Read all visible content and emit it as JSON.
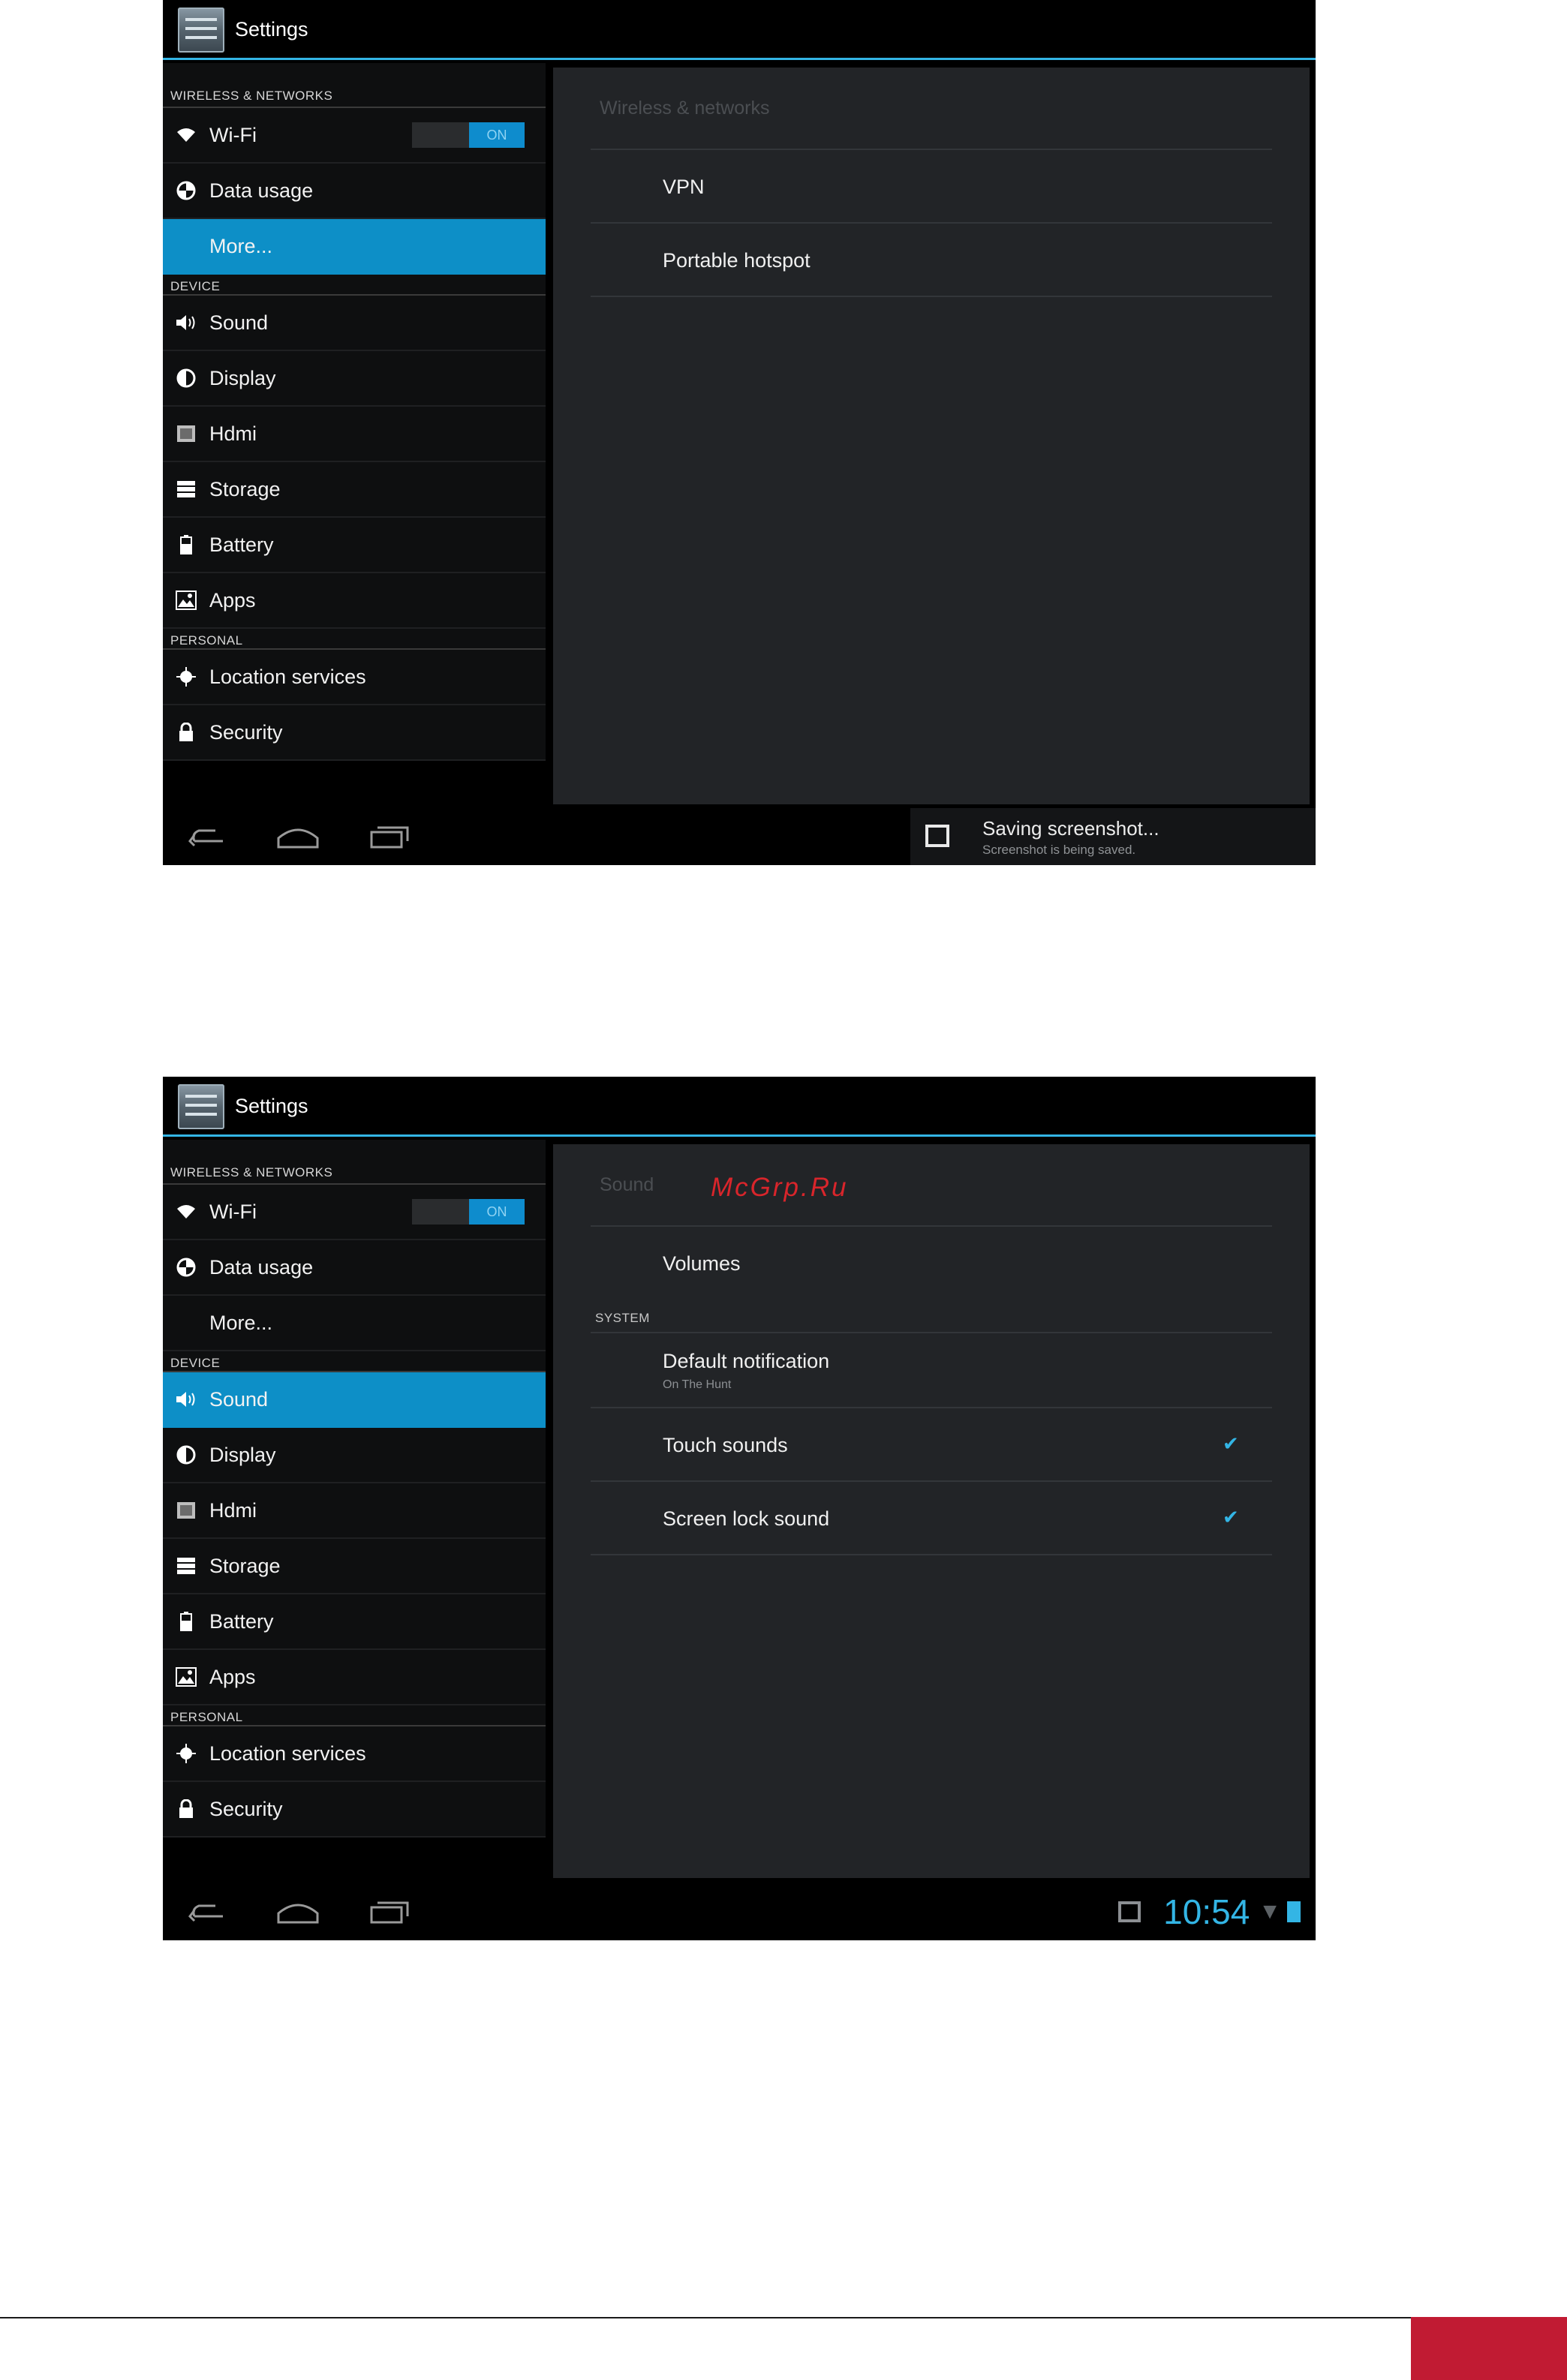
{
  "screen1": {
    "app_title": "Settings",
    "sidebar": {
      "section_wireless": "WIRELESS & NETWORKS",
      "wifi": "Wi-Fi",
      "wifi_toggle": "ON",
      "data_usage": "Data usage",
      "more": "More...",
      "section_device": "DEVICE",
      "sound": "Sound",
      "display": "Display",
      "hdmi": "Hdmi",
      "storage": "Storage",
      "battery": "Battery",
      "apps": "Apps",
      "section_personal": "PERSONAL",
      "location": "Location services",
      "security": "Security"
    },
    "panel": {
      "title": "Wireless & networks",
      "items": [
        "VPN",
        "Portable hotspot"
      ]
    },
    "notification": {
      "title": "Saving screenshot...",
      "subtitle": "Screenshot is being saved."
    }
  },
  "screen2": {
    "app_title": "Settings",
    "sidebar": {
      "section_wireless": "WIRELESS & NETWORKS",
      "wifi": "Wi-Fi",
      "wifi_toggle": "ON",
      "data_usage": "Data usage",
      "more": "More...",
      "section_device": "DEVICE",
      "sound": "Sound",
      "display": "Display",
      "hdmi": "Hdmi",
      "storage": "Storage",
      "battery": "Battery",
      "apps": "Apps",
      "section_personal": "PERSONAL",
      "location": "Location services",
      "security": "Security"
    },
    "panel": {
      "title": "Sound",
      "watermark": "McGrp.Ru",
      "volumes": "Volumes",
      "section_system": "SYSTEM",
      "default_notification": "Default notification",
      "default_notification_value": "On The Hunt",
      "touch_sounds": "Touch sounds",
      "touch_sounds_checked": true,
      "screen_lock_sound": "Screen lock sound",
      "screen_lock_sound_checked": true
    },
    "status": {
      "clock": "10:54"
    }
  },
  "colors": {
    "accent": "#33b5e5",
    "selected": "#0d8fc7",
    "footer_block": "#c11b33",
    "watermark": "#d9252b"
  }
}
